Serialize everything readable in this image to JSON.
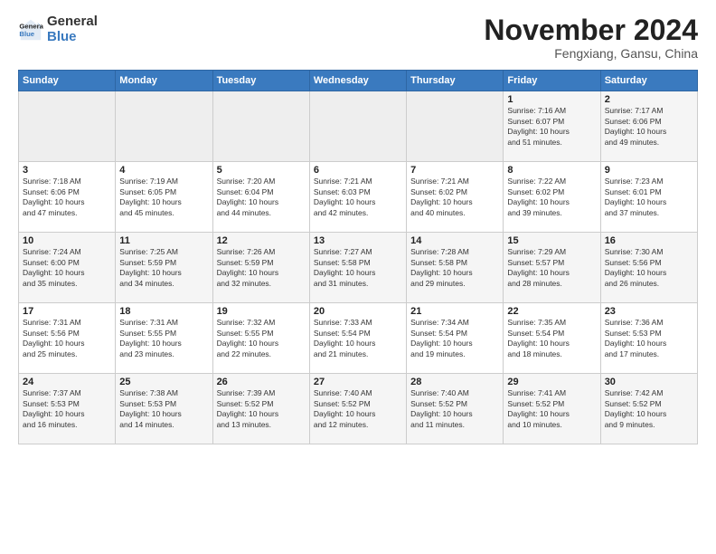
{
  "logo": {
    "line1": "General",
    "line2": "Blue"
  },
  "title": "November 2024",
  "location": "Fengxiang, Gansu, China",
  "header": {
    "days": [
      "Sunday",
      "Monday",
      "Tuesday",
      "Wednesday",
      "Thursday",
      "Friday",
      "Saturday"
    ]
  },
  "weeks": [
    {
      "days": [
        {
          "num": "",
          "info": ""
        },
        {
          "num": "",
          "info": ""
        },
        {
          "num": "",
          "info": ""
        },
        {
          "num": "",
          "info": ""
        },
        {
          "num": "",
          "info": ""
        },
        {
          "num": "1",
          "info": "Sunrise: 7:16 AM\nSunset: 6:07 PM\nDaylight: 10 hours\nand 51 minutes."
        },
        {
          "num": "2",
          "info": "Sunrise: 7:17 AM\nSunset: 6:06 PM\nDaylight: 10 hours\nand 49 minutes."
        }
      ]
    },
    {
      "days": [
        {
          "num": "3",
          "info": "Sunrise: 7:18 AM\nSunset: 6:06 PM\nDaylight: 10 hours\nand 47 minutes."
        },
        {
          "num": "4",
          "info": "Sunrise: 7:19 AM\nSunset: 6:05 PM\nDaylight: 10 hours\nand 45 minutes."
        },
        {
          "num": "5",
          "info": "Sunrise: 7:20 AM\nSunset: 6:04 PM\nDaylight: 10 hours\nand 44 minutes."
        },
        {
          "num": "6",
          "info": "Sunrise: 7:21 AM\nSunset: 6:03 PM\nDaylight: 10 hours\nand 42 minutes."
        },
        {
          "num": "7",
          "info": "Sunrise: 7:21 AM\nSunset: 6:02 PM\nDaylight: 10 hours\nand 40 minutes."
        },
        {
          "num": "8",
          "info": "Sunrise: 7:22 AM\nSunset: 6:02 PM\nDaylight: 10 hours\nand 39 minutes."
        },
        {
          "num": "9",
          "info": "Sunrise: 7:23 AM\nSunset: 6:01 PM\nDaylight: 10 hours\nand 37 minutes."
        }
      ]
    },
    {
      "days": [
        {
          "num": "10",
          "info": "Sunrise: 7:24 AM\nSunset: 6:00 PM\nDaylight: 10 hours\nand 35 minutes."
        },
        {
          "num": "11",
          "info": "Sunrise: 7:25 AM\nSunset: 5:59 PM\nDaylight: 10 hours\nand 34 minutes."
        },
        {
          "num": "12",
          "info": "Sunrise: 7:26 AM\nSunset: 5:59 PM\nDaylight: 10 hours\nand 32 minutes."
        },
        {
          "num": "13",
          "info": "Sunrise: 7:27 AM\nSunset: 5:58 PM\nDaylight: 10 hours\nand 31 minutes."
        },
        {
          "num": "14",
          "info": "Sunrise: 7:28 AM\nSunset: 5:58 PM\nDaylight: 10 hours\nand 29 minutes."
        },
        {
          "num": "15",
          "info": "Sunrise: 7:29 AM\nSunset: 5:57 PM\nDaylight: 10 hours\nand 28 minutes."
        },
        {
          "num": "16",
          "info": "Sunrise: 7:30 AM\nSunset: 5:56 PM\nDaylight: 10 hours\nand 26 minutes."
        }
      ]
    },
    {
      "days": [
        {
          "num": "17",
          "info": "Sunrise: 7:31 AM\nSunset: 5:56 PM\nDaylight: 10 hours\nand 25 minutes."
        },
        {
          "num": "18",
          "info": "Sunrise: 7:31 AM\nSunset: 5:55 PM\nDaylight: 10 hours\nand 23 minutes."
        },
        {
          "num": "19",
          "info": "Sunrise: 7:32 AM\nSunset: 5:55 PM\nDaylight: 10 hours\nand 22 minutes."
        },
        {
          "num": "20",
          "info": "Sunrise: 7:33 AM\nSunset: 5:54 PM\nDaylight: 10 hours\nand 21 minutes."
        },
        {
          "num": "21",
          "info": "Sunrise: 7:34 AM\nSunset: 5:54 PM\nDaylight: 10 hours\nand 19 minutes."
        },
        {
          "num": "22",
          "info": "Sunrise: 7:35 AM\nSunset: 5:54 PM\nDaylight: 10 hours\nand 18 minutes."
        },
        {
          "num": "23",
          "info": "Sunrise: 7:36 AM\nSunset: 5:53 PM\nDaylight: 10 hours\nand 17 minutes."
        }
      ]
    },
    {
      "days": [
        {
          "num": "24",
          "info": "Sunrise: 7:37 AM\nSunset: 5:53 PM\nDaylight: 10 hours\nand 16 minutes."
        },
        {
          "num": "25",
          "info": "Sunrise: 7:38 AM\nSunset: 5:53 PM\nDaylight: 10 hours\nand 14 minutes."
        },
        {
          "num": "26",
          "info": "Sunrise: 7:39 AM\nSunset: 5:52 PM\nDaylight: 10 hours\nand 13 minutes."
        },
        {
          "num": "27",
          "info": "Sunrise: 7:40 AM\nSunset: 5:52 PM\nDaylight: 10 hours\nand 12 minutes."
        },
        {
          "num": "28",
          "info": "Sunrise: 7:40 AM\nSunset: 5:52 PM\nDaylight: 10 hours\nand 11 minutes."
        },
        {
          "num": "29",
          "info": "Sunrise: 7:41 AM\nSunset: 5:52 PM\nDaylight: 10 hours\nand 10 minutes."
        },
        {
          "num": "30",
          "info": "Sunrise: 7:42 AM\nSunset: 5:52 PM\nDaylight: 10 hours\nand 9 minutes."
        }
      ]
    }
  ]
}
